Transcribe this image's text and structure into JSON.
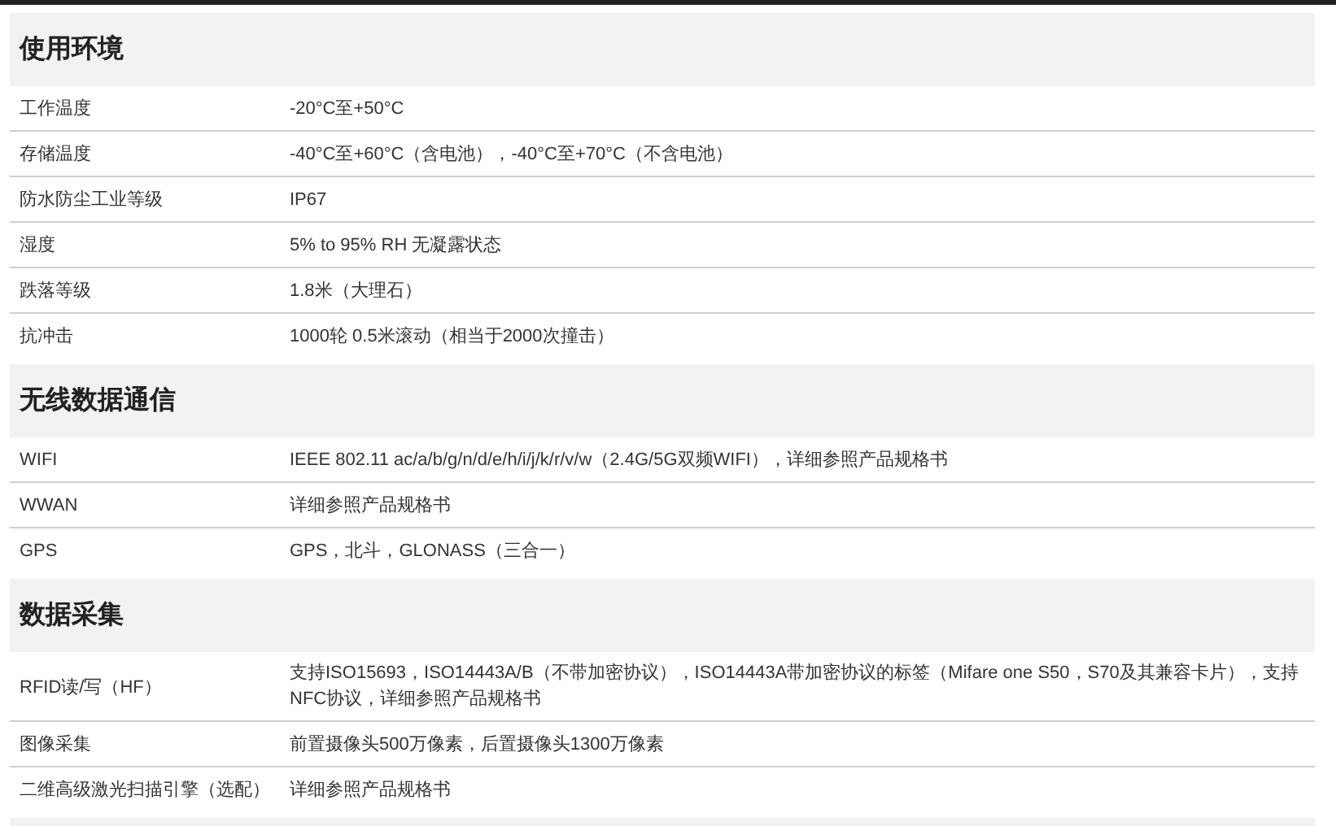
{
  "sections": [
    {
      "title": "使用环境",
      "rows": [
        {
          "label": "工作温度",
          "value": "-20°C至+50°C"
        },
        {
          "label": "存储温度",
          "value": "-40°C至+60°C（含电池），-40°C至+70°C（不含电池）"
        },
        {
          "label": "防水防尘工业等级",
          "value": "IP67"
        },
        {
          "label": "湿度",
          "value": "5% to 95% RH 无凝露状态"
        },
        {
          "label": "跌落等级",
          "value": "1.8米（大理石）"
        },
        {
          "label": "抗冲击",
          "value": "1000轮 0.5米滚动（相当于2000次撞击）"
        }
      ]
    },
    {
      "title": "无线数据通信",
      "rows": [
        {
          "label": "WIFI",
          "value": "IEEE 802.11 ac/a/b/g/n/d/e/h/i/j/k/r/v/w（2.4G/5G双频WIFI），详细参照产品规格书"
        },
        {
          "label": "WWAN",
          "value": "详细参照产品规格书"
        },
        {
          "label": "GPS",
          "value": "GPS，北斗，GLONASS（三合一）"
        }
      ]
    },
    {
      "title": "数据采集",
      "rows": [
        {
          "label": "RFID读/写（HF）",
          "value": "支持ISO15693，ISO14443A/B（不带加密协议），ISO14443A带加密协议的标签（Mifare one S50，S70及其兼容卡片），支持NFC协议，详细参照产品规格书"
        },
        {
          "label": "图像采集",
          "value": "前置摄像头500万像素，后置摄像头1300万像素"
        },
        {
          "label": "二维高级激光扫描引擎（选配）",
          "value": "详细参照产品规格书"
        }
      ]
    }
  ]
}
